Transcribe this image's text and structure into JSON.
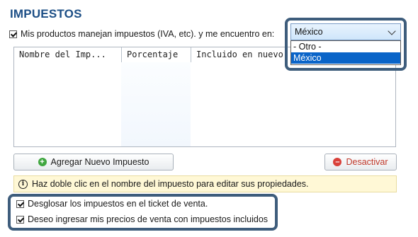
{
  "section": {
    "title": "IMPUESTOS",
    "taxes_label": "Mis productos manejan impuestos (IVA, etc). y me encuentro en:"
  },
  "country_select": {
    "value": "México",
    "options": [
      "- Otro -",
      "México"
    ],
    "selected_index": 1
  },
  "table": {
    "columns": [
      "Nombre del Imp...",
      "Porcentaje",
      "Incluido en nuevo"
    ],
    "rows": []
  },
  "buttons": {
    "add_label": "Agregar Nuevo Impuesto",
    "deactivate_label": "Desactivar"
  },
  "info": {
    "text": "Haz doble clic en el nombre del impuesto para editar sus propiedades."
  },
  "options": {
    "breakdown_label": "Desglosar los impuestos en el ticket de venta.",
    "prices_include_label": "Deseo ingresar mis precios de venta con impuestos incluidos"
  },
  "colors": {
    "title": "#1d4f86",
    "frame": "#3e5d7c",
    "selected_option": "#0a64c8",
    "info_bg": "#fff8d6"
  }
}
